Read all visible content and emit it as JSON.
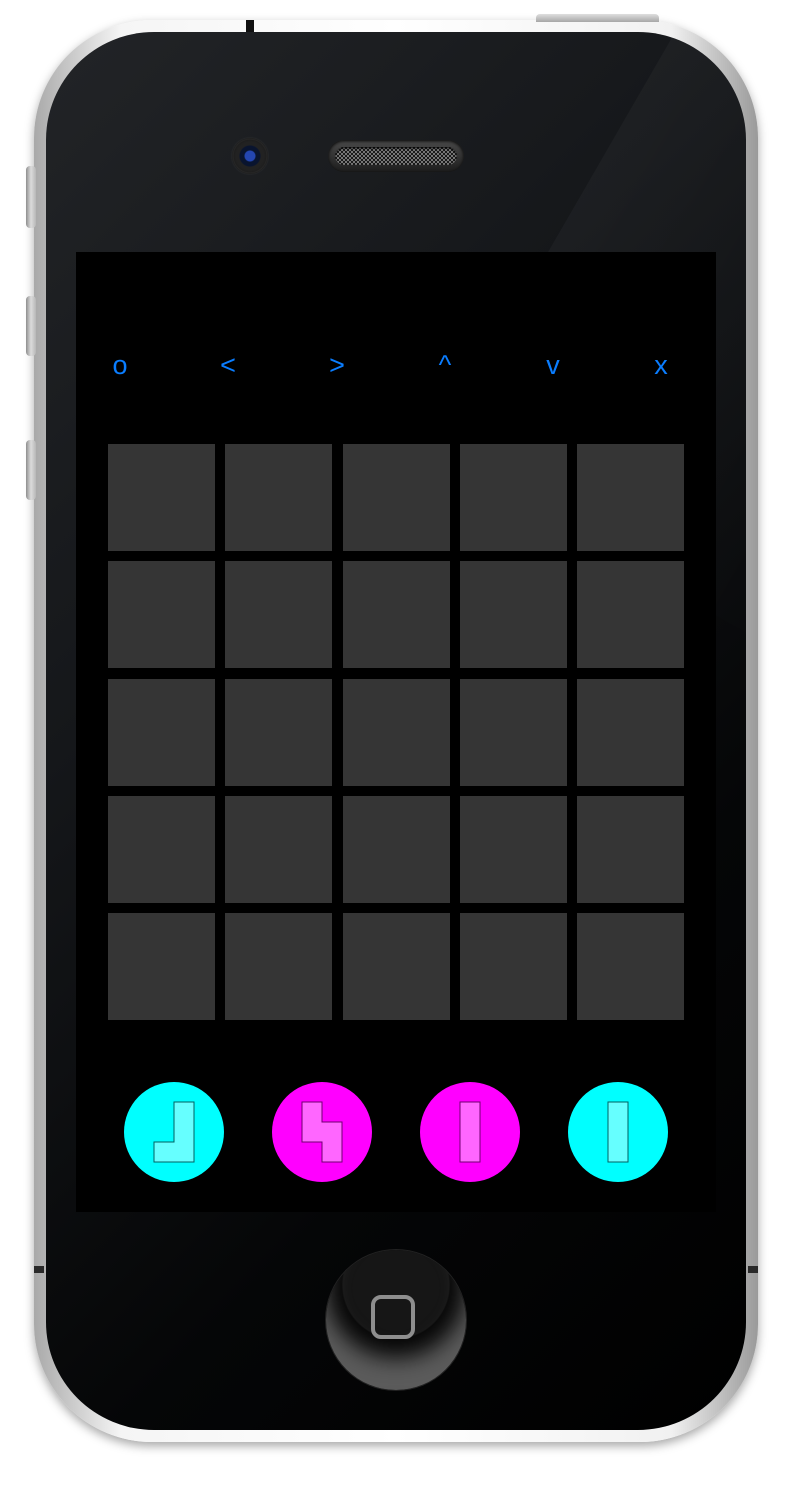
{
  "app": {
    "title": ""
  },
  "controls": [
    {
      "id": "rotate",
      "label": "o",
      "icon": "rotate-icon"
    },
    {
      "id": "left",
      "label": "<",
      "icon": "left-arrow-icon"
    },
    {
      "id": "right",
      "label": ">",
      "icon": "right-arrow-icon"
    },
    {
      "id": "up",
      "label": "^",
      "icon": "up-arrow-icon"
    },
    {
      "id": "down",
      "label": "v",
      "icon": "down-arrow-icon"
    },
    {
      "id": "close",
      "label": "x",
      "icon": "close-icon"
    }
  ],
  "board": {
    "rows": 5,
    "columns": 5,
    "cells": [
      "",
      "",
      "",
      "",
      "",
      "",
      "",
      "",
      "",
      "",
      "",
      "",
      "",
      "",
      "",
      "",
      "",
      "",
      "",
      "",
      "",
      "",
      "",
      "",
      ""
    ],
    "empty_color": "#353535"
  },
  "pieces": [
    {
      "name": "l-piece",
      "fill": "#00ffff",
      "shape_color": "#66ffff",
      "icon": "l-tetromino-icon"
    },
    {
      "name": "s-piece",
      "fill": "#ff00ff",
      "shape_color": "#ff66ff",
      "icon": "s-tetromino-icon"
    },
    {
      "name": "i-piece-magenta",
      "fill": "#ff00ff",
      "shape_color": "#ff66ff",
      "icon": "bar-tetromino-icon"
    },
    {
      "name": "i-piece-cyan",
      "fill": "#00ffff",
      "shape_color": "#66ffff",
      "icon": "bar-tetromino-icon"
    }
  ],
  "theme": {
    "accent": "#0a7dff",
    "screen_background": "#000000"
  }
}
